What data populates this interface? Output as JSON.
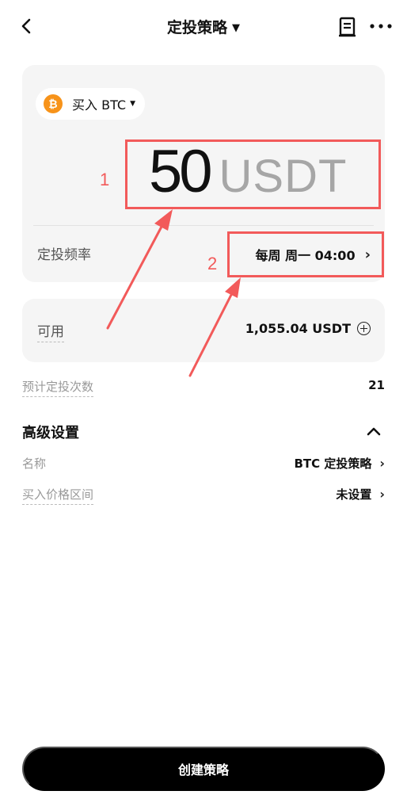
{
  "header": {
    "title": "定投策略",
    "title_caret": "▼",
    "icons": [
      "back-arrow-icon",
      "document-icon",
      "more-icon"
    ]
  },
  "order_card": {
    "coin_selector": {
      "label": "买入 BTC",
      "caret": "▼",
      "coin_icon_glyph": "₿"
    },
    "amount": {
      "value": "50",
      "unit": "USDT"
    },
    "frequency": {
      "label": "定投频率",
      "value": "每周 周一 04:00",
      "chevron": "›"
    }
  },
  "available": {
    "label": "可用",
    "value": "1,055.04 USDT"
  },
  "estimate": {
    "label": "预计定投次数",
    "value": "21"
  },
  "advanced": {
    "title": "高级设置",
    "rows": [
      {
        "label": "名称",
        "value": "BTC 定投策略",
        "chevron": "›"
      },
      {
        "label": "买入价格区间",
        "value": "未设置",
        "chevron": "›"
      }
    ]
  },
  "annotations": [
    {
      "number": "1",
      "target": "amount"
    },
    {
      "number": "2",
      "target": "frequency"
    }
  ],
  "create_button": {
    "label": "创建策略"
  },
  "colors": {
    "annotation": "#f25a5a",
    "btc": "#f7931a",
    "card_bg": "#f5f5f5",
    "button_bg": "#000000",
    "unit_grey": "#a6a6a6"
  }
}
